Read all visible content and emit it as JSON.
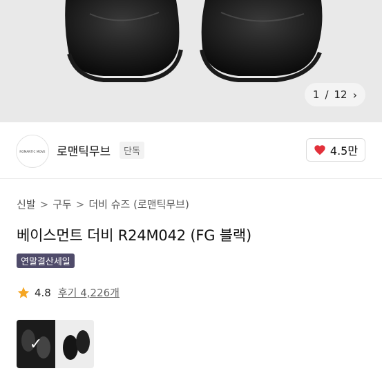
{
  "gallery": {
    "pager_current": "1",
    "pager_sep": "/",
    "pager_total": "12",
    "next_icon": "chevron-right-icon"
  },
  "brand": {
    "logo_text": "ROMANTIC MOVE",
    "name": "로맨틱무브",
    "badge": "단독",
    "like_count": "4.5만",
    "like_icon": "heart-icon",
    "like_color": "#e2303a"
  },
  "breadcrumb": {
    "items": [
      "신발",
      "구두",
      "더비 슈즈 (로맨틱무브)"
    ],
    "separator": ">"
  },
  "product": {
    "title": "베이스먼트 더비 R24M042 (FG 블랙)",
    "sale_tag": "연말결산세일",
    "sale_tag_color": "#4f4b6a"
  },
  "rating": {
    "icon": "star-icon",
    "star_color": "#f5a623",
    "score": "4.8",
    "review_label": "후기 4,226개"
  },
  "thumbnails": {
    "selected_index": 0,
    "selected_icon": "checkmark-icon",
    "check_glyph": "✓"
  }
}
